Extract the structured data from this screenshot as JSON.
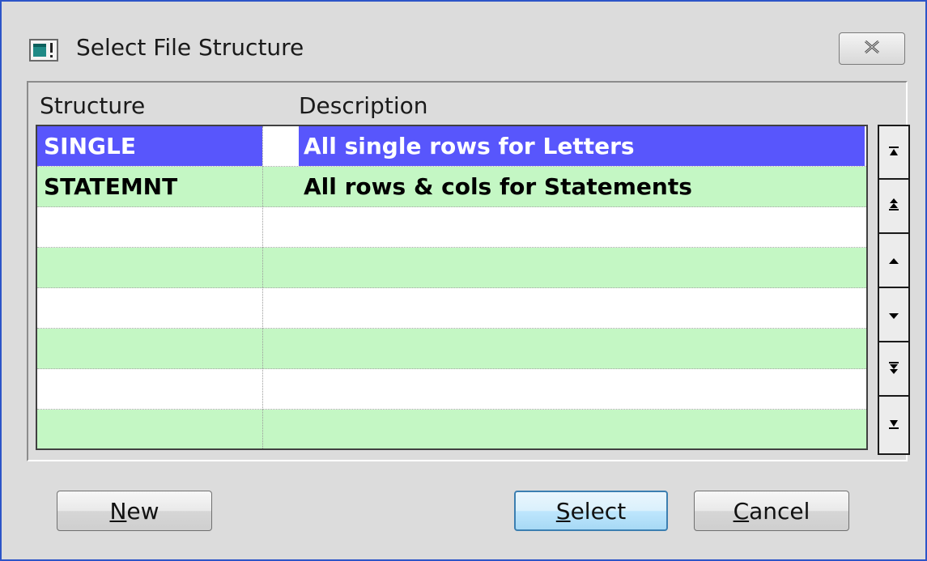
{
  "window": {
    "title": "Select File Structure",
    "icon": "app-window-icon",
    "close_icon": "close-x-icon"
  },
  "table": {
    "columns": [
      "Structure",
      "Description"
    ],
    "rows": [
      {
        "structure": "SINGLE",
        "description": "All single rows for Letters",
        "selected": true
      },
      {
        "structure": "STATEMNT",
        "description": "All rows & cols for Statements",
        "selected": false
      },
      {
        "structure": "",
        "description": "",
        "selected": false
      },
      {
        "structure": "",
        "description": "",
        "selected": false
      },
      {
        "structure": "",
        "description": "",
        "selected": false
      },
      {
        "structure": "",
        "description": "",
        "selected": false
      },
      {
        "structure": "",
        "description": "",
        "selected": false
      },
      {
        "structure": "",
        "description": "",
        "selected": false
      }
    ]
  },
  "scroll_buttons": [
    "scroll-first-icon",
    "scroll-page-up-icon",
    "scroll-up-icon",
    "scroll-down-icon",
    "scroll-page-down-icon",
    "scroll-last-icon"
  ],
  "buttons": {
    "new": {
      "accel": "N",
      "rest": "ew"
    },
    "select": {
      "accel": "S",
      "rest": "elect"
    },
    "cancel": {
      "accel": "C",
      "rest": "ancel"
    }
  },
  "colors": {
    "selection": "#5856fc",
    "row_alt": "#c4f7c4",
    "window_border": "#2d55c8"
  }
}
